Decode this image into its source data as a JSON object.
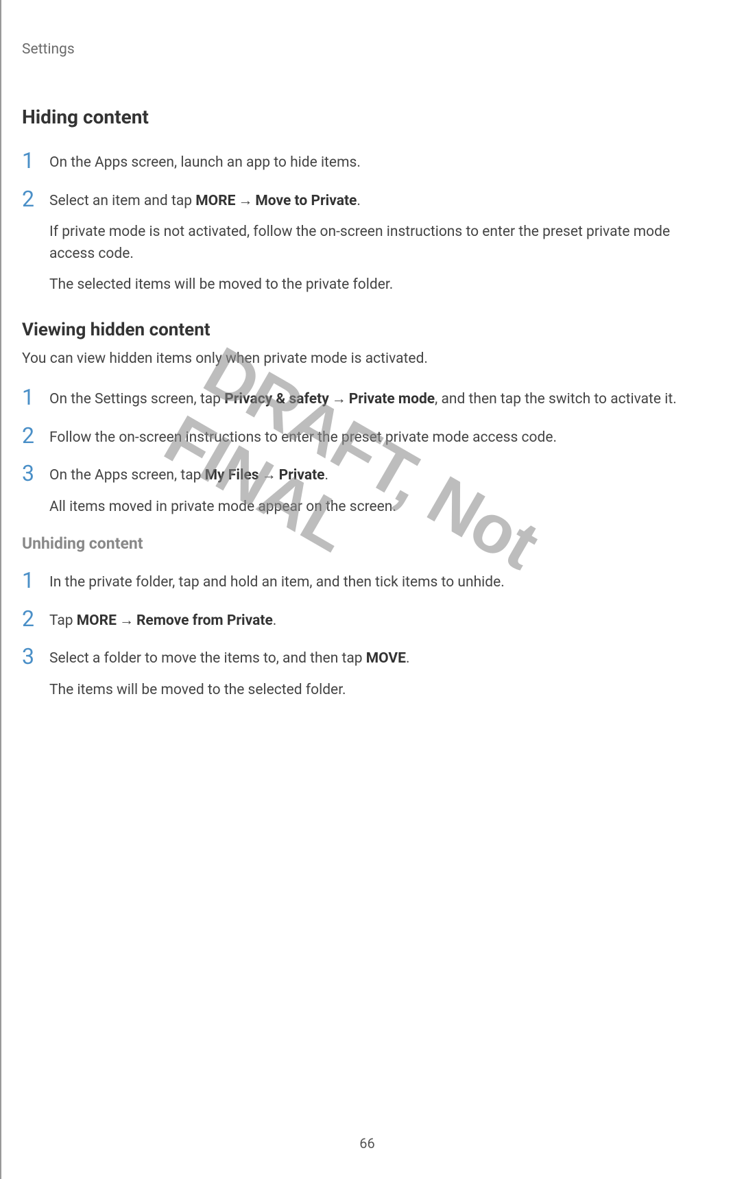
{
  "header": "Settings",
  "watermark": "DRAFT, Not FINAL",
  "pageNumber": "66",
  "section1": {
    "title": "Hiding content",
    "steps": [
      {
        "num": "1",
        "lines": [
          "On the Apps screen, launch an app to hide items."
        ]
      },
      {
        "num": "2",
        "prefix": "Select an item and tap ",
        "bold1": "MORE",
        "arrow": " → ",
        "bold2": "Move to Private",
        "suffix": ".",
        "extra1": "If private mode is not activated, follow the on-screen instructions to enter the preset private mode access code.",
        "extra2": "The selected items will be moved to the private folder."
      }
    ]
  },
  "section2": {
    "title": "Viewing hidden content",
    "intro": "You can view hidden items only when private mode is activated.",
    "steps": [
      {
        "num": "1",
        "prefix": "On the Settings screen, tap ",
        "bold1": "Privacy & safety",
        "arrow": " → ",
        "bold2": "Private mode",
        "suffix": ", and then tap the switch to activate it."
      },
      {
        "num": "2",
        "text": "Follow the on-screen instructions to enter the preset private mode access code."
      },
      {
        "num": "3",
        "prefix": "On the Apps screen, tap ",
        "bold1": "My Files",
        "arrow": " → ",
        "bold2": "Private",
        "suffix": ".",
        "extra1": "All items moved in private mode appear on the screen."
      }
    ]
  },
  "section3": {
    "title": "Unhiding content",
    "steps": [
      {
        "num": "1",
        "text": "In the private folder, tap and hold an item, and then tick items to unhide."
      },
      {
        "num": "2",
        "prefix": "Tap ",
        "bold1": "MORE",
        "arrow": " → ",
        "bold2": "Remove from Private",
        "suffix": "."
      },
      {
        "num": "3",
        "prefix": "Select a folder to move the items to, and then tap ",
        "bold1": "MOVE",
        "suffix": ".",
        "extra1": "The items will be moved to the selected folder."
      }
    ]
  }
}
